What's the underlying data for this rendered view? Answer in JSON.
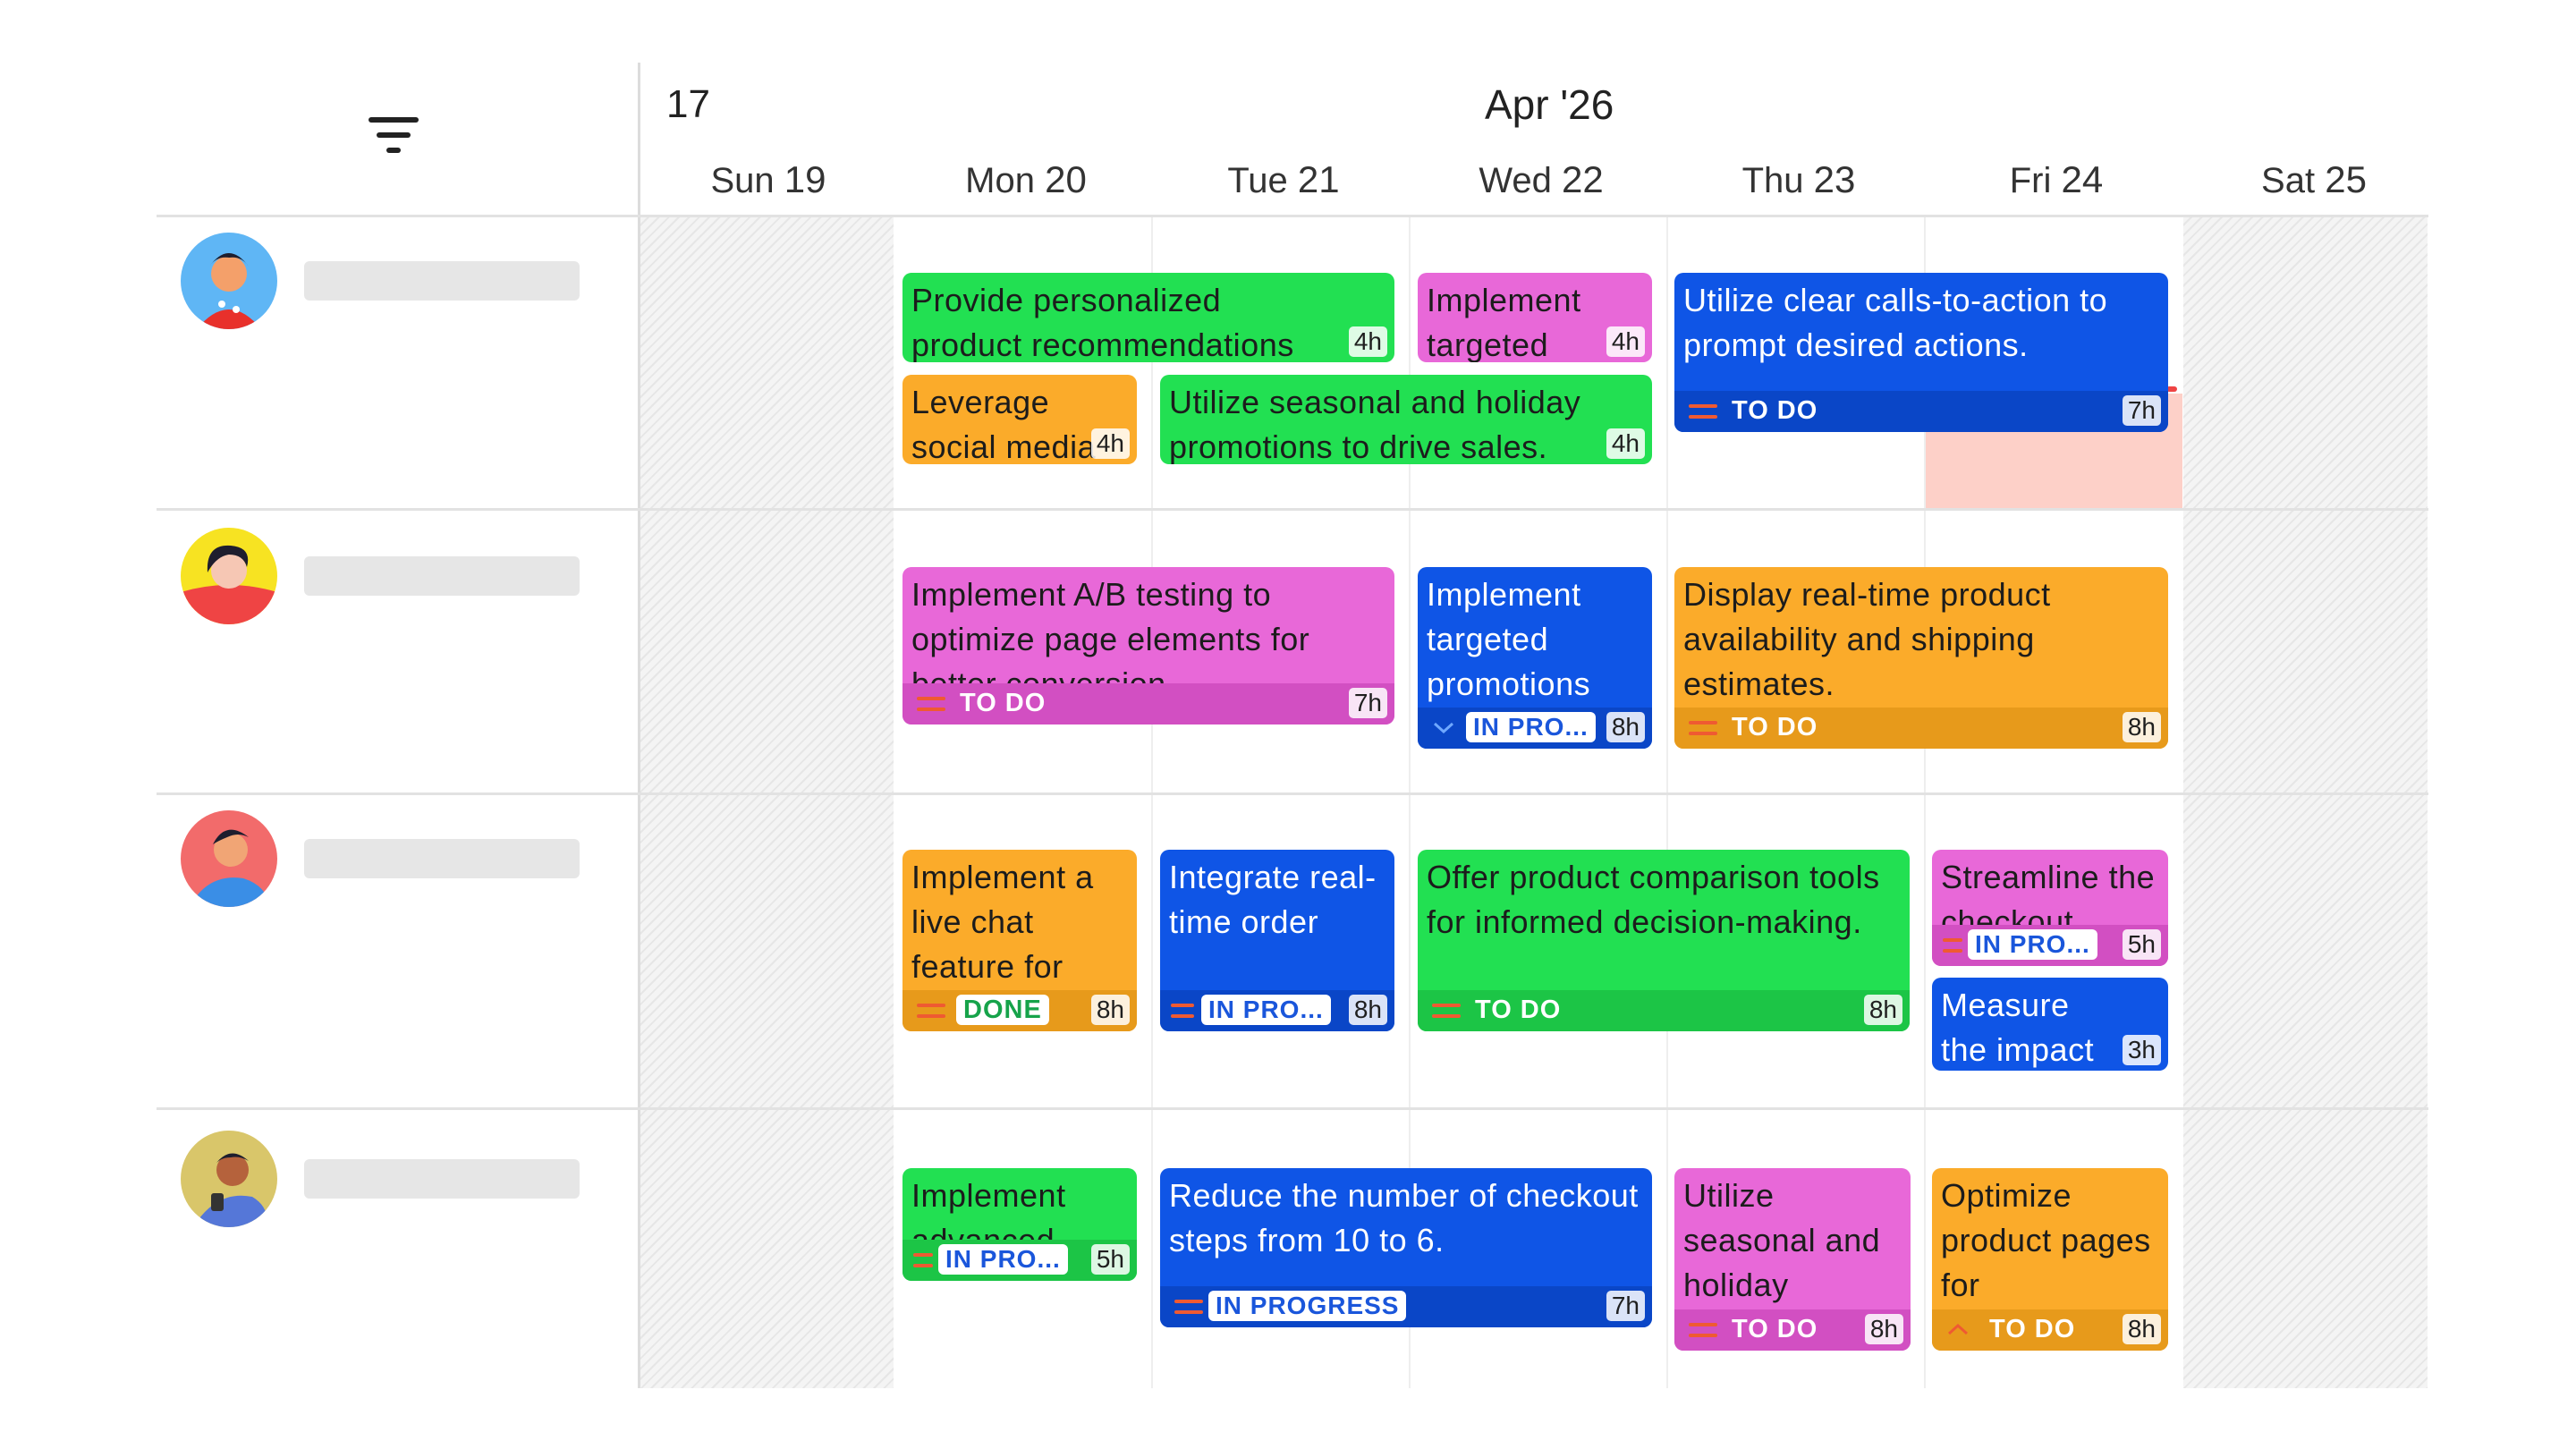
{
  "header": {
    "week_number": "17",
    "month": "Apr '26",
    "days": [
      {
        "name": "Sun",
        "num": "19"
      },
      {
        "name": "Mon",
        "num": "20"
      },
      {
        "name": "Tue",
        "num": "21"
      },
      {
        "name": "Wed",
        "num": "22"
      },
      {
        "name": "Thu",
        "num": "23"
      },
      {
        "name": "Fri",
        "num": "24"
      },
      {
        "name": "Sat",
        "num": "25"
      }
    ]
  },
  "icons": {
    "filter": "filter-icon",
    "priority_medium": "equals-icon",
    "priority_low": "chevron-down-icon",
    "priority_high": "chevron-up-icon"
  },
  "colors": {
    "green": "#22e052",
    "pink": "#e868d8",
    "orange": "#fbab2a",
    "blue": "#0f55e6",
    "overdue": "#fdd0c8"
  },
  "tasks": {
    "r1_a": {
      "title": "Provide personalized product recommendations based on",
      "hours": "4h"
    },
    "r1_b": {
      "title": "Implement targeted",
      "hours": "4h"
    },
    "r1_c": {
      "title": "Utilize clear calls-to-action to prompt desired actions.",
      "status": "TO DO",
      "hours": "7h"
    },
    "r1_d": {
      "title": "Leverage social media",
      "hours": "4h"
    },
    "r1_e": {
      "title": "Utilize seasonal and holiday promotions to drive sales.",
      "hours": "4h"
    },
    "r2_a": {
      "title": "Implement A/B testing to optimize page elements for better conversion",
      "status": "TO DO",
      "hours": "7h"
    },
    "r2_b": {
      "title": "Implement targeted promotions",
      "status": "IN PRO...",
      "hours": "8h"
    },
    "r2_c": {
      "title": "Display real-time product availability and shipping estimates.",
      "status": "TO DO",
      "hours": "8h"
    },
    "r3_a": {
      "title": "Implement a live chat feature for",
      "status": "DONE",
      "hours": "8h"
    },
    "r3_b": {
      "title": "Integrate real-time order",
      "status": "IN PRO...",
      "hours": "8h"
    },
    "r3_c": {
      "title": "Offer product comparison tools for informed decision-making.",
      "status": "TO DO",
      "hours": "8h"
    },
    "r3_d": {
      "title": "Streamline the checkout",
      "status": "IN PRO...",
      "hours": "5h"
    },
    "r3_e": {
      "title": "Measure the impact of",
      "hours": "3h"
    },
    "r4_a": {
      "title": "Implement advanced",
      "status": "IN PRO...",
      "hours": "5h"
    },
    "r4_b": {
      "title": "Reduce the number of checkout steps from 10 to 6.",
      "status": "IN PROGRESS",
      "hours": "7h"
    },
    "r4_c": {
      "title": "Utilize seasonal and holiday",
      "status": "TO DO",
      "hours": "8h"
    },
    "r4_d": {
      "title": "Optimize product pages for",
      "status": "TO DO",
      "hours": "8h"
    }
  }
}
